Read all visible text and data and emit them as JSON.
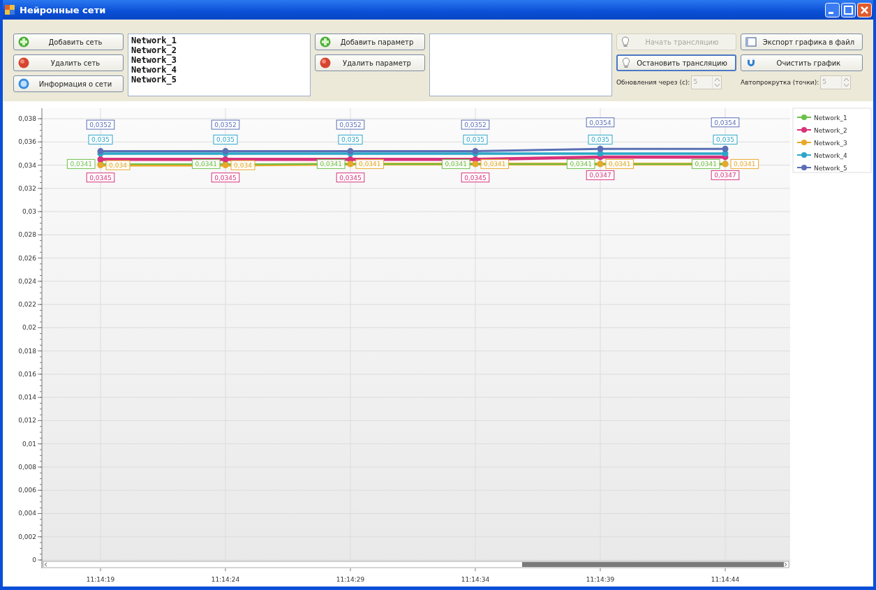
{
  "window": {
    "title": "Нейронные сети"
  },
  "toolbar": {
    "network_buttons": [
      {
        "label": "Добавить сеть",
        "kind": "add"
      },
      {
        "label": "Удалить сеть",
        "kind": "remove"
      },
      {
        "label": "Информация о сети",
        "kind": "info"
      }
    ],
    "networks": [
      "Network_1",
      "Network_2",
      "Network_3",
      "Network_4",
      "Network_5"
    ],
    "parameter_buttons": [
      {
        "label": "Добавить параметр",
        "kind": "add"
      },
      {
        "label": "Удалить параметр",
        "kind": "remove"
      }
    ],
    "broadcast_buttons": [
      {
        "label": "Начать трансляцию",
        "disabled": true,
        "focused": false
      },
      {
        "label": "Остановить трансляцию",
        "disabled": false,
        "focused": true
      }
    ],
    "update_interval": {
      "label": "Обновления через (с):",
      "value": "5",
      "disabled": true
    },
    "graph_buttons": [
      {
        "label": "Экспорт графика в файл",
        "kind": "export"
      },
      {
        "label": "Очистить график",
        "kind": "clear"
      }
    ],
    "autoscroll": {
      "label": "Автопрокрутка (точки):",
      "value": "5",
      "disabled": true
    }
  },
  "chart": {
    "chart_data": {
      "type": "line",
      "categories": [
        "11:14:19",
        "11:14:24",
        "11:14:29",
        "11:14:34",
        "11:14:39",
        "11:14:44"
      ],
      "ylim": [
        0,
        0.038
      ],
      "yticks": [
        {
          "value": 0,
          "label": "0"
        },
        {
          "value": 0.002,
          "label": "0,002"
        },
        {
          "value": 0.004,
          "label": "0,004"
        },
        {
          "value": 0.006,
          "label": "0,006"
        },
        {
          "value": 0.008,
          "label": "0,008"
        },
        {
          "value": 0.01,
          "label": "0,01"
        },
        {
          "value": 0.012,
          "label": "0,012"
        },
        {
          "value": 0.014,
          "label": "0,014"
        },
        {
          "value": 0.016,
          "label": "0,016"
        },
        {
          "value": 0.018,
          "label": "0,018"
        },
        {
          "value": 0.02,
          "label": "0,02"
        },
        {
          "value": 0.022,
          "label": "0,022"
        },
        {
          "value": 0.024,
          "label": "0,024"
        },
        {
          "value": 0.026,
          "label": "0,026"
        },
        {
          "value": 0.028,
          "label": "0,028"
        },
        {
          "value": 0.03,
          "label": "0,03"
        },
        {
          "value": 0.032,
          "label": "0,032"
        },
        {
          "value": 0.034,
          "label": "0,034"
        },
        {
          "value": 0.036,
          "label": "0,036"
        },
        {
          "value": 0.038,
          "label": "0,038"
        }
      ],
      "data_labels": true,
      "grid": true,
      "legend": "right",
      "series": [
        {
          "name": "Network_1",
          "color": "#6cc04a",
          "marker": "circle",
          "values": [
            0.0341,
            0.0341,
            0.0341,
            0.0341,
            0.0341,
            0.0341
          ],
          "value_labels": [
            "0,0341",
            "0,0341",
            "0,0341",
            "0,0341",
            "0,0341",
            "0,0341"
          ]
        },
        {
          "name": "Network_2",
          "color": "#d8327a",
          "marker": "circle",
          "values": [
            0.0345,
            0.0345,
            0.0345,
            0.0345,
            0.0347,
            0.0347
          ],
          "value_labels": [
            "0,0345",
            "0,0345",
            "0,0345",
            "0,0345",
            "0,0347",
            "0,0347"
          ]
        },
        {
          "name": "Network_3",
          "color": "#e8a82a",
          "marker": "circle",
          "values": [
            0.034,
            0.034,
            0.0341,
            0.0341,
            0.0341,
            0.0341
          ],
          "value_labels": [
            "0,034",
            "0,034",
            "0,0341",
            "0,0341",
            "0,0341",
            "0,0341"
          ]
        },
        {
          "name": "Network_4",
          "color": "#2ba6c8",
          "marker": "circle",
          "values": [
            0.035,
            0.035,
            0.035,
            0.035,
            0.035,
            0.035
          ],
          "value_labels": [
            "0,035",
            "0,035",
            "0,035",
            "0,035",
            "0,035",
            "0,035"
          ]
        },
        {
          "name": "Network_5",
          "color": "#5b6fb5",
          "marker": "circle",
          "values": [
            0.0352,
            0.0352,
            0.0352,
            0.0352,
            0.0354,
            0.0354
          ],
          "value_labels": [
            "0,0352",
            "0,0352",
            "0,0352",
            "0,0352",
            "0,0354",
            "0,0354"
          ]
        }
      ]
    }
  }
}
